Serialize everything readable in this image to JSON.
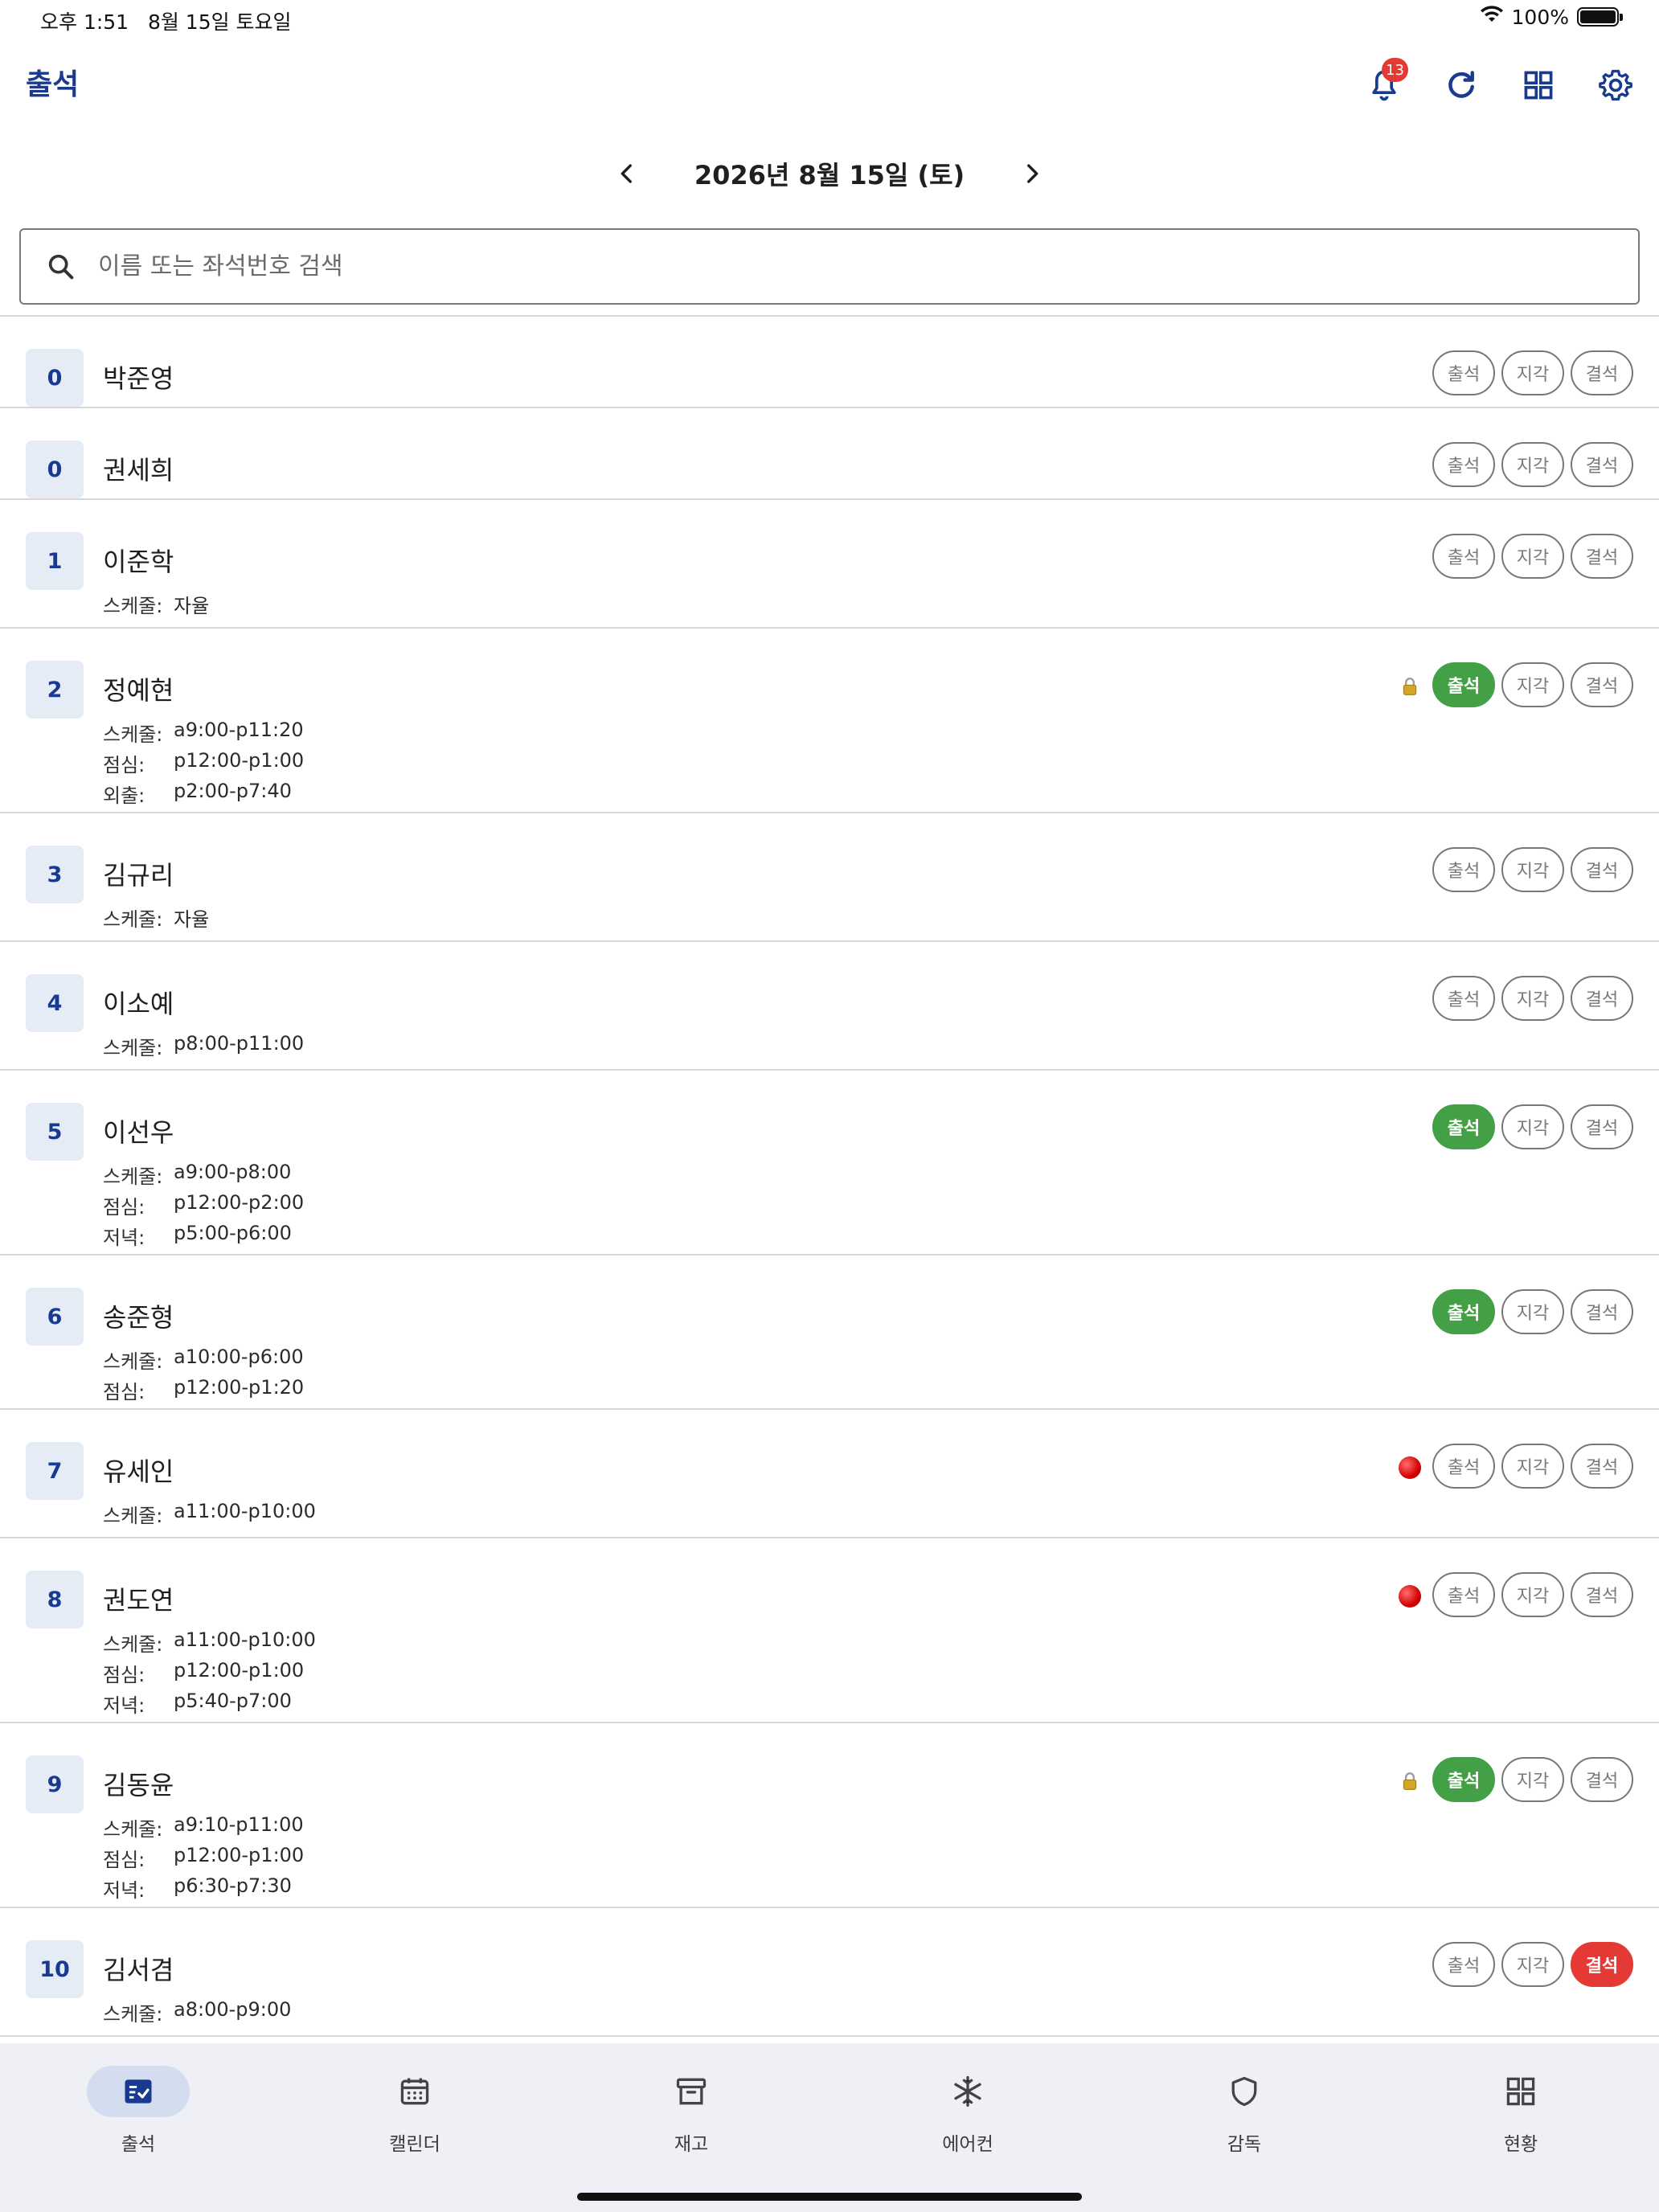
{
  "status_bar": {
    "time": "오후 1:51",
    "date": "8월 15일 토요일",
    "battery": "100%"
  },
  "app_bar": {
    "title": "출석",
    "notification_count": "13"
  },
  "date_nav": {
    "label": "2026년 8월 15일 (토)"
  },
  "search": {
    "placeholder": "이름 또는 좌석번호 검색"
  },
  "colors": {
    "primary": "#1a3a8f",
    "present": "#43a047",
    "absent": "#e53935",
    "seat_bg": "#e5ecf6",
    "nav_bg": "#eef0f5"
  },
  "status_labels": {
    "present": "출석",
    "late": "지각",
    "absent": "결석"
  },
  "students": [
    {
      "seat": "0",
      "name": "박준영",
      "schedule": [],
      "status": "",
      "indicator": ""
    },
    {
      "seat": "0",
      "name": "권세희",
      "schedule": [],
      "status": "",
      "indicator": ""
    },
    {
      "seat": "1",
      "name": "이준학",
      "schedule": [
        {
          "label": "스케줄:",
          "value": "자율"
        }
      ],
      "status": "",
      "indicator": ""
    },
    {
      "seat": "2",
      "name": "정예현",
      "schedule": [
        {
          "label": "스케줄:",
          "value": "a9:00-p11:20"
        },
        {
          "label": "점심:",
          "value": "p12:00-p1:00"
        },
        {
          "label": "외출:",
          "value": "p2:00-p7:40"
        }
      ],
      "status": "present",
      "indicator": "lock-icon"
    },
    {
      "seat": "3",
      "name": "김규리",
      "schedule": [
        {
          "label": "스케줄:",
          "value": "자율"
        }
      ],
      "status": "",
      "indicator": ""
    },
    {
      "seat": "4",
      "name": "이소예",
      "schedule": [
        {
          "label": "스케줄:",
          "value": "p8:00-p11:00"
        }
      ],
      "status": "",
      "indicator": ""
    },
    {
      "seat": "5",
      "name": "이선우",
      "schedule": [
        {
          "label": "스케줄:",
          "value": "a9:00-p8:00"
        },
        {
          "label": "점심:",
          "value": "p12:00-p2:00"
        },
        {
          "label": "저녁:",
          "value": "p5:00-p6:00"
        }
      ],
      "status": "present",
      "indicator": ""
    },
    {
      "seat": "6",
      "name": "송준형",
      "schedule": [
        {
          "label": "스케줄:",
          "value": "a10:00-p6:00"
        },
        {
          "label": "점심:",
          "value": "p12:00-p1:20"
        }
      ],
      "status": "present",
      "indicator": ""
    },
    {
      "seat": "7",
      "name": "유세인",
      "schedule": [
        {
          "label": "스케줄:",
          "value": "a11:00-p10:00"
        }
      ],
      "status": "",
      "indicator": "red-dot-icon"
    },
    {
      "seat": "8",
      "name": "권도연",
      "schedule": [
        {
          "label": "스케줄:",
          "value": "a11:00-p10:00"
        },
        {
          "label": "점심:",
          "value": "p12:00-p1:00"
        },
        {
          "label": "저녁:",
          "value": "p5:40-p7:00"
        }
      ],
      "status": "",
      "indicator": "red-dot-icon"
    },
    {
      "seat": "9",
      "name": "김동윤",
      "schedule": [
        {
          "label": "스케줄:",
          "value": "a9:10-p11:00"
        },
        {
          "label": "점심:",
          "value": "p12:00-p1:00"
        },
        {
          "label": "저녁:",
          "value": "p6:30-p7:30"
        }
      ],
      "status": "present",
      "indicator": "lock-icon"
    },
    {
      "seat": "10",
      "name": "김서겸",
      "schedule": [
        {
          "label": "스케줄:",
          "value": "a8:00-p9:00"
        }
      ],
      "status": "absent",
      "indicator": ""
    }
  ],
  "bottom_nav": [
    {
      "label": "출석",
      "icon": "attendance-icon",
      "active": true
    },
    {
      "label": "캘린더",
      "icon": "calendar-icon",
      "active": false
    },
    {
      "label": "재고",
      "icon": "archive-icon",
      "active": false
    },
    {
      "label": "에어컨",
      "icon": "snowflake-icon",
      "active": false
    },
    {
      "label": "감독",
      "icon": "shield-icon",
      "active": false
    },
    {
      "label": "현황",
      "icon": "grid-icon",
      "active": false
    }
  ]
}
